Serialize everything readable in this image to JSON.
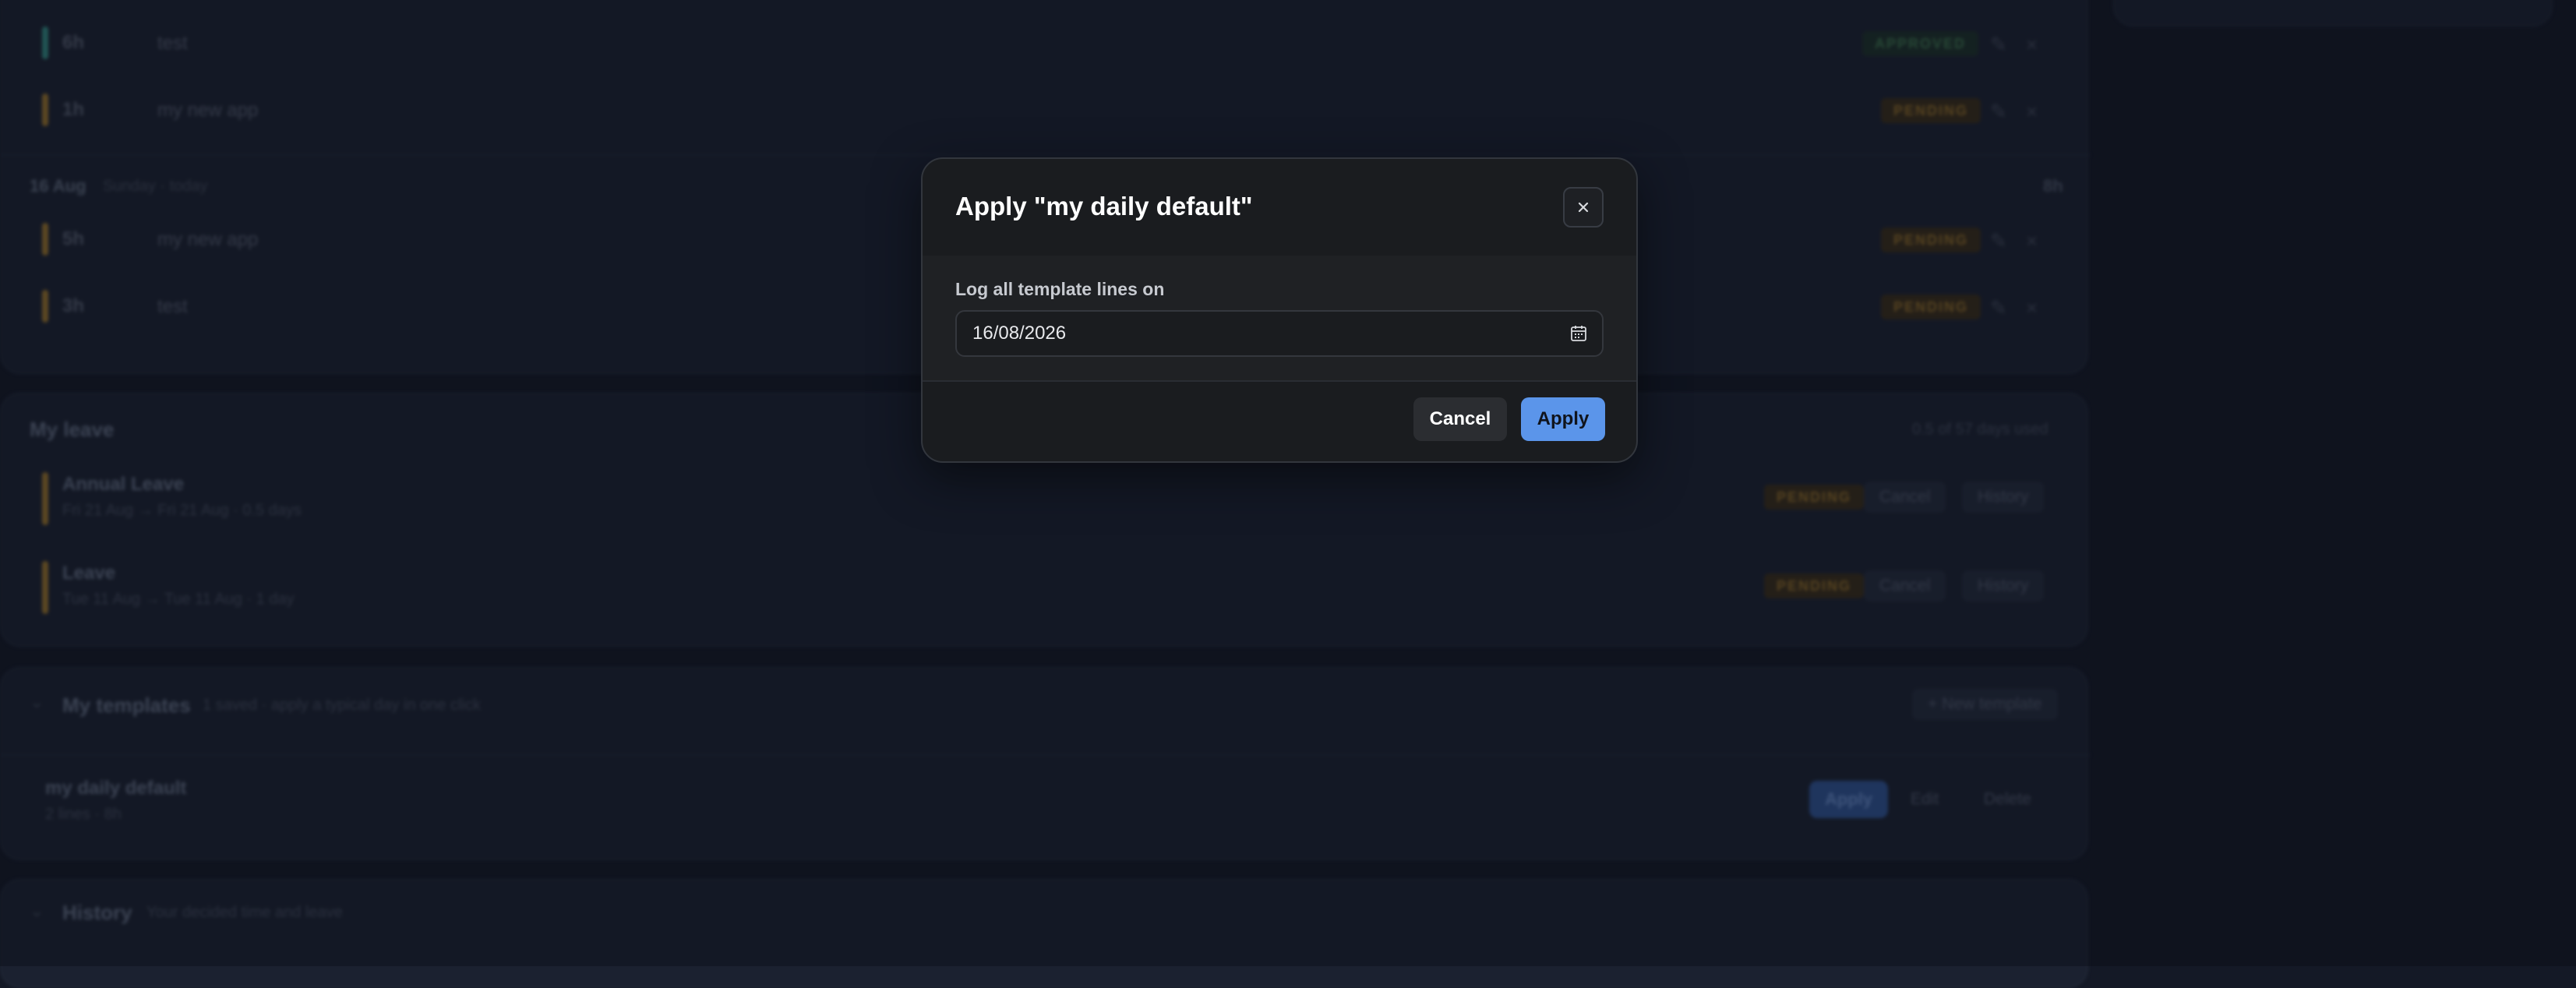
{
  "entries_today_prev": [
    {
      "hours": "6h",
      "desc": "test",
      "status": "APPROVED"
    },
    {
      "hours": "1h",
      "desc": "my new app",
      "status": "PENDING"
    }
  ],
  "day": {
    "date": "16 Aug",
    "sub": "Sunday · today",
    "total": "8h"
  },
  "entries_day": [
    {
      "hours": "5h",
      "desc": "my new app",
      "status": "PENDING"
    },
    {
      "hours": "3h",
      "desc": "test",
      "status": "PENDING"
    }
  ],
  "leave": {
    "title": "My leave",
    "summary": "0.5 of 57 days used",
    "items": [
      {
        "type": "Annual Leave",
        "range": "Fri 21 Aug → Fri 21 Aug · 0.5 days",
        "status": "PENDING",
        "cancel": "Cancel",
        "history": "History"
      },
      {
        "type": "Leave",
        "range": "Tue 11 Aug → Tue 11 Aug · 1 day",
        "status": "PENDING",
        "cancel": "Cancel",
        "history": "History"
      }
    ]
  },
  "templates": {
    "title": "My templates",
    "subtitle": "1 saved · apply a typical day in one click",
    "new_button": "+ New template",
    "items": [
      {
        "name": "my daily default",
        "meta": "2 lines · 8h",
        "apply": "Apply",
        "edit": "Edit",
        "delete": "Delete"
      }
    ]
  },
  "history": {
    "title": "History",
    "subtitle": "Your decided time and leave"
  },
  "modal": {
    "title": "Apply \"my daily default\"",
    "field_label": "Log all template lines on",
    "date_value": "16/08/2026",
    "cancel_label": "Cancel",
    "apply_label": "Apply"
  },
  "colors": {
    "accent": "#5b95ea",
    "pending": "#836429",
    "approved": "#3a6b4b",
    "teal_bar": "#2f7d78",
    "amber_bar": "#8a6a2c"
  }
}
